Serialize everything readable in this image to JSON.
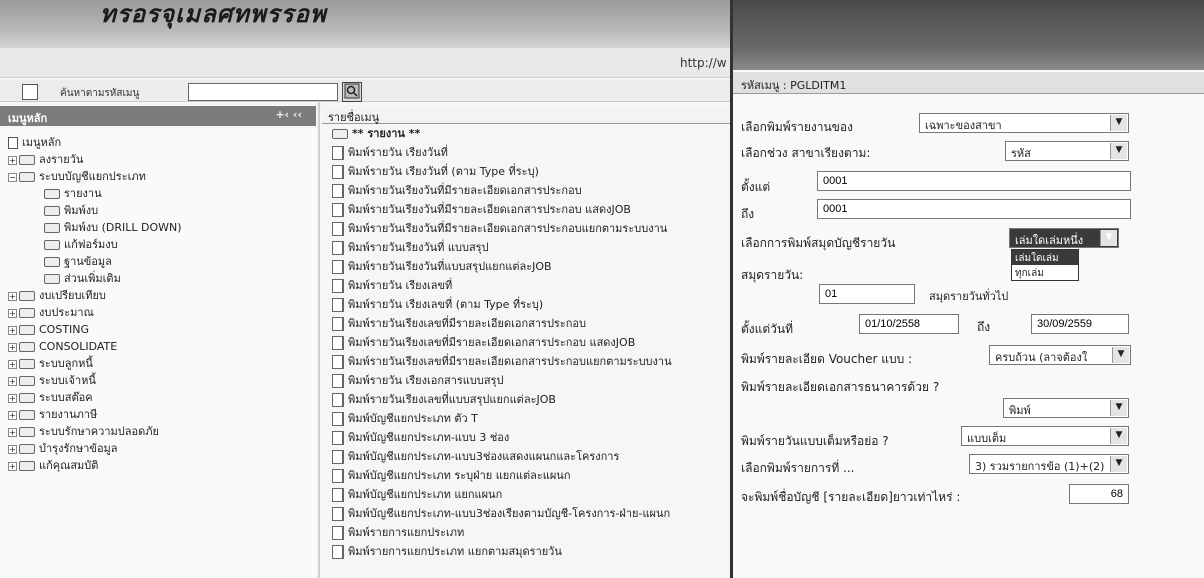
{
  "top": {
    "title_fragment": "ทรอรจุเมลศทพรรอพ",
    "url": "http://w"
  },
  "search": {
    "label": "ค้นหาตามรหัสเมนู",
    "value": ""
  },
  "left_panel": {
    "header": "เมนูหลัก",
    "header_icons": "+‹ ‹‹",
    "tree": [
      {
        "label": "เมนูหลัก",
        "level": 0,
        "expander": ""
      },
      {
        "label": "ลงรายวัน",
        "level": 1,
        "expander": "+"
      },
      {
        "label": "ระบบบัญชีแยกประเภท",
        "level": 1,
        "expander": "−"
      },
      {
        "label": "รายงาน",
        "level": 2,
        "expander": ""
      },
      {
        "label": "พิมพ์งบ",
        "level": 2,
        "expander": ""
      },
      {
        "label": "พิมพ์งบ (DRILL DOWN)",
        "level": 2,
        "expander": ""
      },
      {
        "label": "แก้ฟอร์มงบ",
        "level": 2,
        "expander": ""
      },
      {
        "label": "ฐานข้อมูล",
        "level": 2,
        "expander": ""
      },
      {
        "label": "ส่วนเพิ่มเติม",
        "level": 2,
        "expander": ""
      },
      {
        "label": "งบเปรียบเทียบ",
        "level": 1,
        "expander": "+"
      },
      {
        "label": "งบประมาณ",
        "level": 1,
        "expander": "+"
      },
      {
        "label": "COSTING",
        "level": 1,
        "expander": "+"
      },
      {
        "label": "CONSOLIDATE",
        "level": 1,
        "expander": "+"
      },
      {
        "label": "ระบบลูกหนี้",
        "level": 1,
        "expander": "+"
      },
      {
        "label": "ระบบเจ้าหนี้",
        "level": 1,
        "expander": "+"
      },
      {
        "label": "ระบบสต๊อค",
        "level": 1,
        "expander": "+"
      },
      {
        "label": "รายงานภาษี",
        "level": 1,
        "expander": "+"
      },
      {
        "label": "ระบบรักษาความปลอดภัย",
        "level": 1,
        "expander": "+"
      },
      {
        "label": "บำรุงรักษาข้อมูล",
        "level": 1,
        "expander": "+"
      },
      {
        "label": "แก้คุณสมบัติ",
        "level": 1,
        "expander": "+"
      }
    ]
  },
  "middle_panel": {
    "header": "รายชื่อเมนู",
    "items": [
      "** รายงาน **",
      "พิมพ์รายวัน เรียงวันที่",
      "พิมพ์รายวัน เรียงวันที่ (ตาม Type ที่ระบุ)",
      "พิมพ์รายวันเรียงวันที่มีรายละเอียดเอกสารประกอบ",
      "พิมพ์รายวันเรียงวันที่มีรายละเอียดเอกสารประกอบ แสดงJOB",
      "พิมพ์รายวันเรียงวันที่มีรายละเอียดเอกสารประกอบแยกตามระบบงาน",
      "พิมพ์รายวันเรียงวันที่ แบบสรุป",
      "พิมพ์รายวันเรียงวันที่แบบสรุปแยกแต่ละJOB",
      "พิมพ์รายวัน เรียงเลขที่",
      "พิมพ์รายวัน เรียงเลขที่ (ตาม Type ที่ระบุ)",
      "พิมพ์รายวันเรียงเลขที่มีรายละเอียดเอกสารประกอบ",
      "พิมพ์รายวันเรียงเลขที่มีรายละเอียดเอกสารประกอบ แสดงJOB",
      "พิมพ์รายวันเรียงเลขที่มีรายละเอียดเอกสารประกอบแยกตามระบบงาน",
      "พิมพ์รายวัน เรียงเอกสารแบบสรุป",
      "พิมพ์รายวันเรียงเลขที่แบบสรุปแยกแต่ละJOB",
      "พิมพ์บัญชีแยกประเภท ตัว T",
      "พิมพ์บัญชีแยกประเภท-แบบ 3 ช่อง",
      "พิมพ์บัญชีแยกประเภท-แบบ3ช่องแสดงแผนกและโครงการ",
      "พิมพ์บัญชีแยกประเภท ระบุฝ่าย แยกแต่ละแผนก",
      "พิมพ์บัญชีแยกประเภท แยกแผนก",
      "พิมพ์บัญชีแยกประเภท-แบบ3ช่องเรียงตามบัญชี-โครงการ-ฝ่าย-แผนก",
      "พิมพ์รายการแยกประเภท",
      "พิมพ์รายการแยกประเภท แยกตามสมุดรายวัน"
    ]
  },
  "right_panel": {
    "code_label": "รหัสเมนู : PGLDITM1",
    "print_report_of_label": "เลือกพิมพ์รายงานของ",
    "print_report_of_value": "เฉพาะของสาขา",
    "sort_branch_label": "เลือกช่วง สาขาเรียงตาม:",
    "sort_branch_value": "รหัส",
    "from_label": "ตั้งแต่",
    "from_value": "0001",
    "to_label": "ถึง",
    "to_value": "0001",
    "journal_print_label": "เลือกการพิมพ์สมุดบัญชีรายวัน",
    "journal_print_value": "เล่มใดเล่มหนึ่ง",
    "journal_options": [
      "เล่มใดเล่มหนึ่ง",
      "ทุกเล่ม"
    ],
    "journal_label": "สมุดรายวัน:",
    "journal_code": "01",
    "journal_name": "สมุดรายวันทั่วไป",
    "date_from_label": "ตั้งแต่วันที่",
    "date_from": "01/10/2558",
    "date_to_label": "ถึง",
    "date_to": "30/09/2559",
    "voucher_label": "พิมพ์รายละเอียด Voucher แบบ :",
    "voucher_value": "ครบถ้วน (ลาจต้องใ",
    "bank_doc_label": "พิมพ์รายละเอียดเอกสารธนาคารด้วย ?",
    "bank_doc_value": "พิมพ์",
    "full_format_label": "พิมพ์รายวันแบบเต็มหรือย่อ ?",
    "full_format_value": "แบบเต็ม",
    "item_select_label": "เลือกพิมพ์รายการที่ ...",
    "item_select_value": "3) รวมรายการข้อ (1)+(2)",
    "account_len_label": "จะพิมพ์ชื่อบัญชี [รายละเอียด]ยาวเท่าไหร่ :",
    "account_len_value": "68"
  }
}
